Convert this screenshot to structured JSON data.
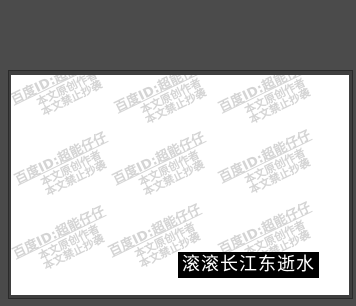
{
  "watermark": {
    "line1": "百度ID:超能仔仔",
    "line2": "本文原创作者",
    "line3": "本文禁止抄袭"
  },
  "caption": {
    "text": "滚滚长江东逝水"
  },
  "colors": {
    "workspace": "#4b4b4b",
    "canvas": "#ffffff",
    "watermark": "#d2d2d2",
    "caption_bg": "#000000",
    "caption_fg": "#ffffff"
  }
}
